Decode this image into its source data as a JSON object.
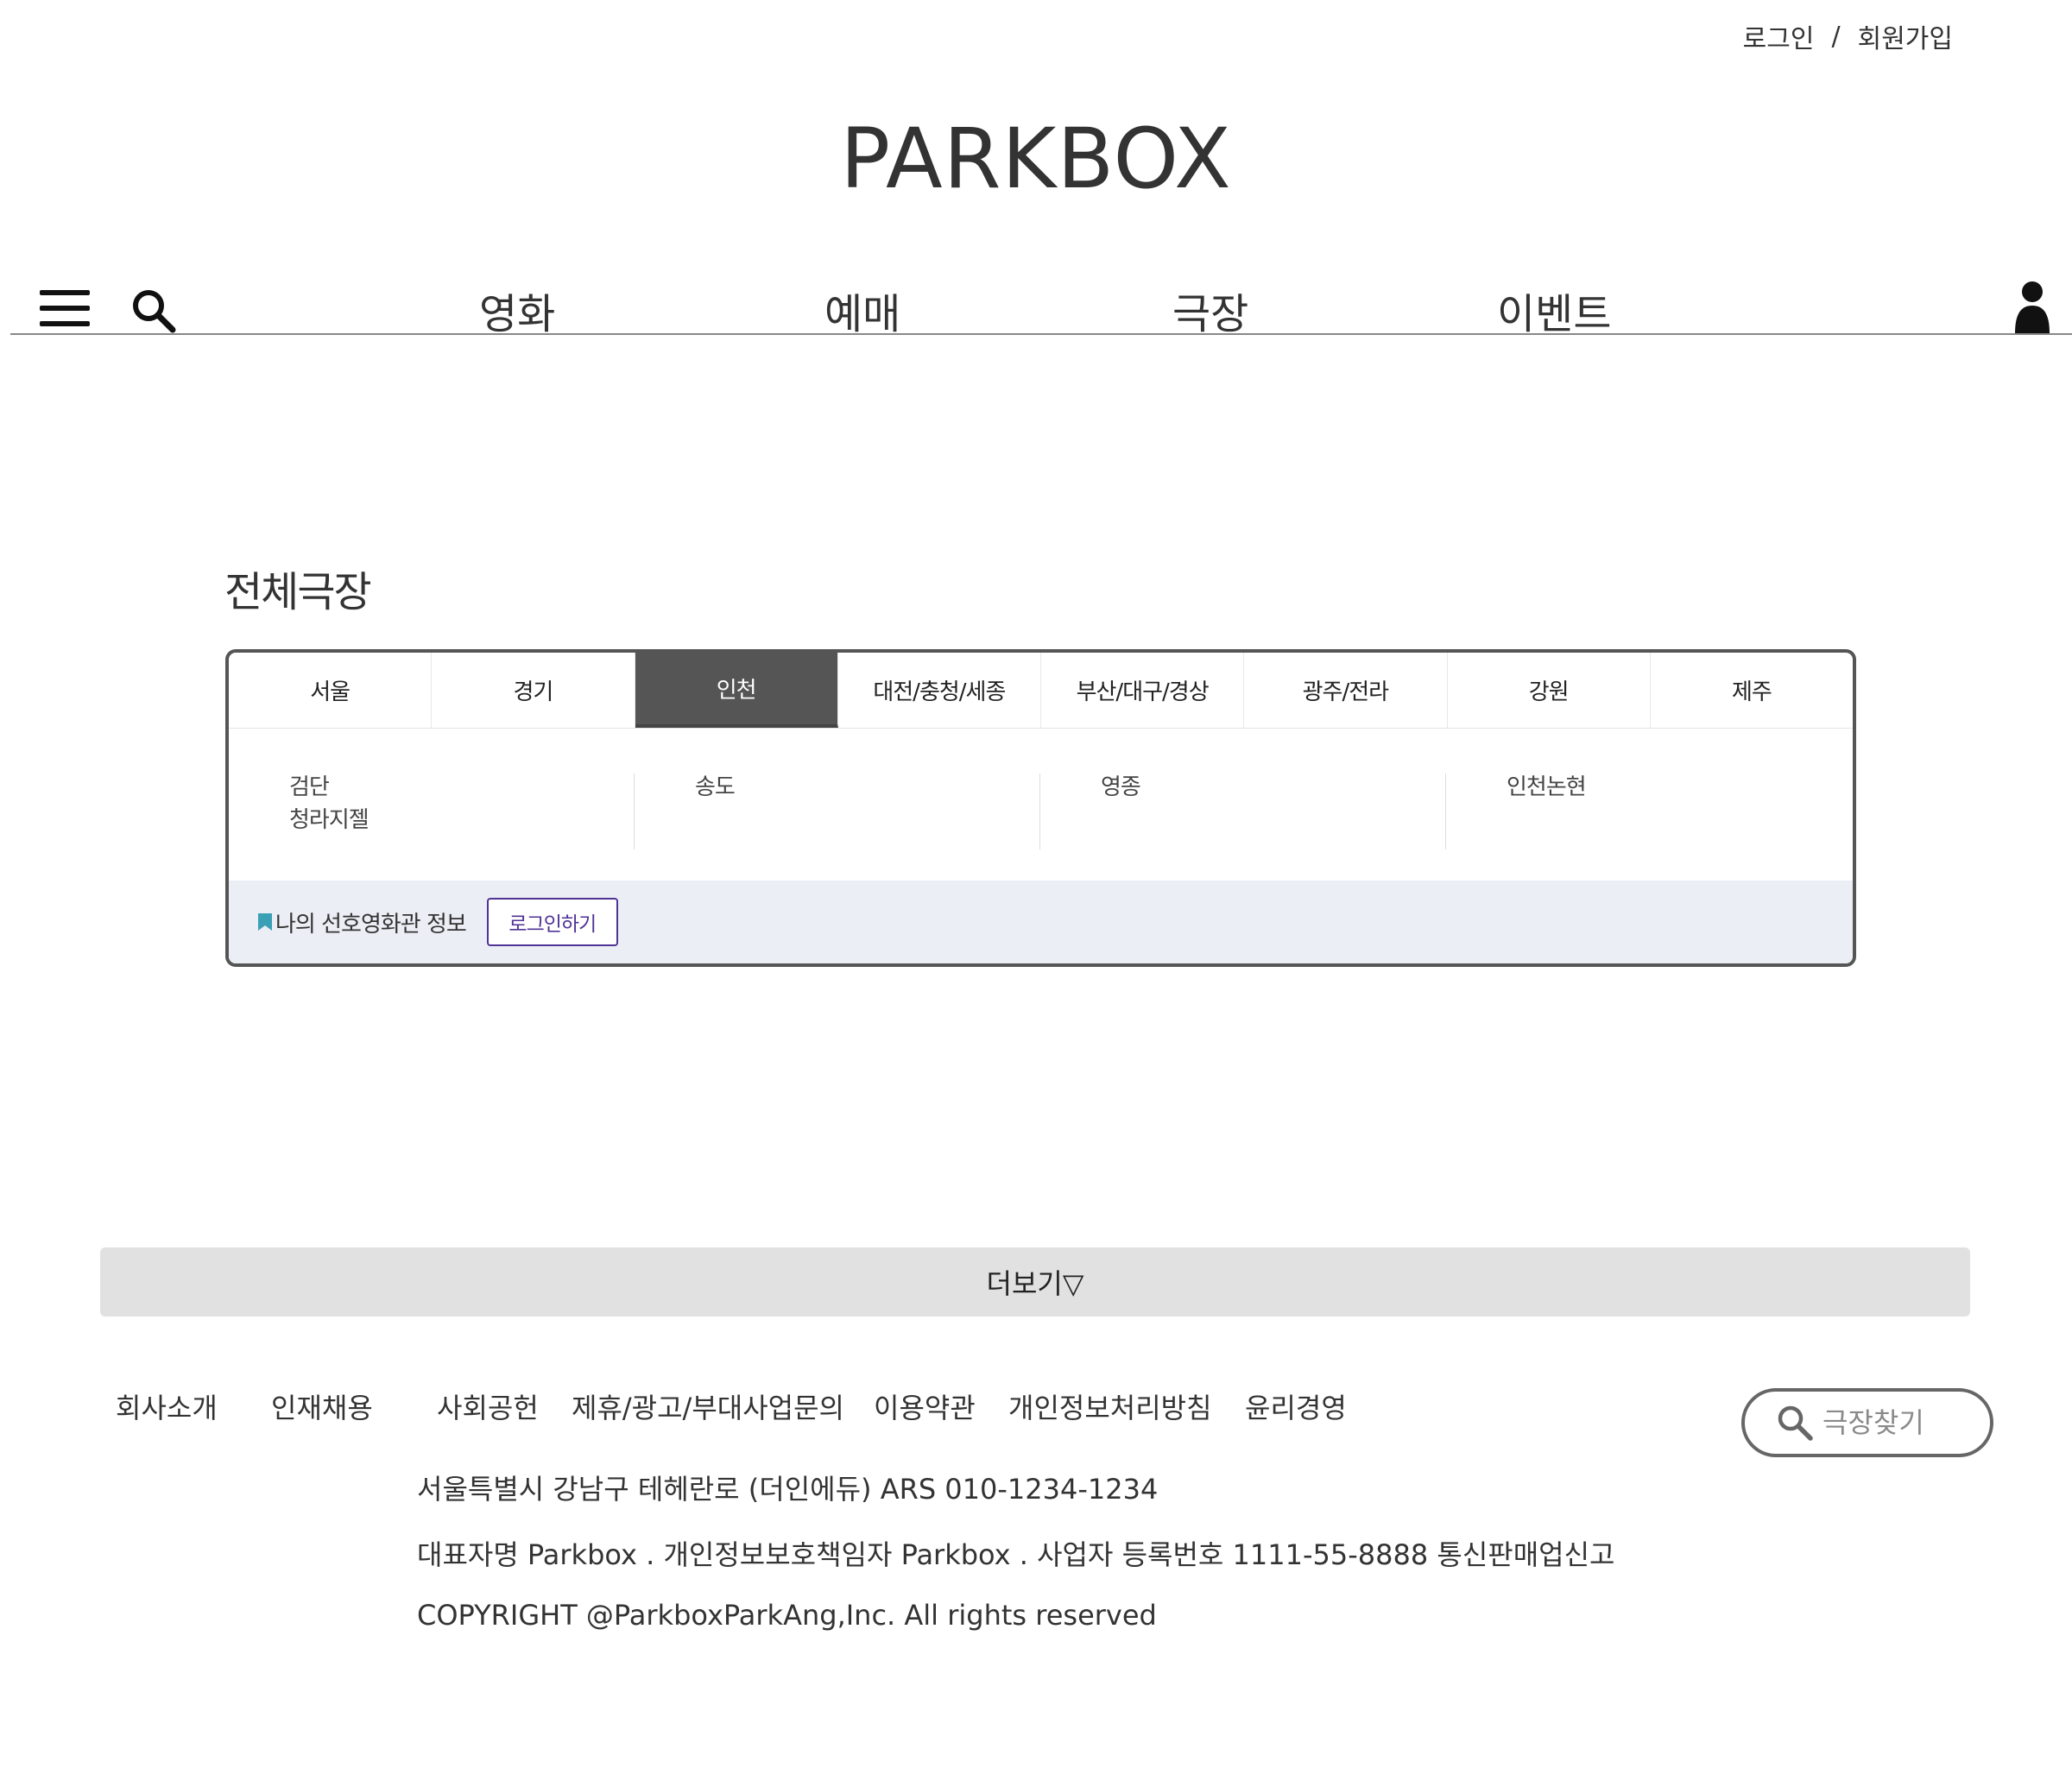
{
  "header": {
    "login_label": "로그인",
    "separator": "/",
    "signup_label": "회원가입",
    "logo_text": "PARKBOX"
  },
  "nav": {
    "menu_icon": "hamburger-menu-icon",
    "search_icon": "search-icon",
    "user_icon": "user-icon",
    "items": [
      {
        "label": "영화"
      },
      {
        "label": "예매"
      },
      {
        "label": "극장"
      },
      {
        "label": "이벤트"
      }
    ]
  },
  "theaters": {
    "title": "전체극장",
    "regions": [
      {
        "label": "서울"
      },
      {
        "label": "경기"
      },
      {
        "label": "인천",
        "active": true
      },
      {
        "label": "대전/충청/세종"
      },
      {
        "label": "부산/대구/경상"
      },
      {
        "label": "광주/전라"
      },
      {
        "label": "강원"
      },
      {
        "label": "제주"
      }
    ],
    "branch_columns": [
      [
        "검단",
        "청라지젤"
      ],
      [
        "송도"
      ],
      [
        "영종"
      ],
      [
        "인천논현"
      ]
    ],
    "preference": {
      "label": "나의 선호영화관 정보",
      "login_button": "로그인하기",
      "bookmark_icon": "bookmark-icon",
      "bookmark_color": "#3aa0b5"
    },
    "active_tab_color": "#555555"
  },
  "more_button": "더보기▽",
  "footer": {
    "links": [
      {
        "label": "회사소개"
      },
      {
        "label": "인재채용"
      },
      {
        "label": "사회공헌"
      },
      {
        "label": "제휴/광고/부대사업문의"
      },
      {
        "label": "이용약관"
      },
      {
        "label": "개인정보처리방침"
      },
      {
        "label": "윤리경영"
      }
    ],
    "search_placeholder": "극장찾기",
    "address": "서울특별시 강남구 테헤란로 (더인에듀) ARS 010-1234-1234",
    "company": "대표자명 Parkbox . 개인정보보호책임자 Parkbox . 사업자 등록번호 1111-55-8888 통신판매업신고",
    "copyright": "COPYRIGHT @ParkboxParkAng,Inc. All rights reserved"
  }
}
